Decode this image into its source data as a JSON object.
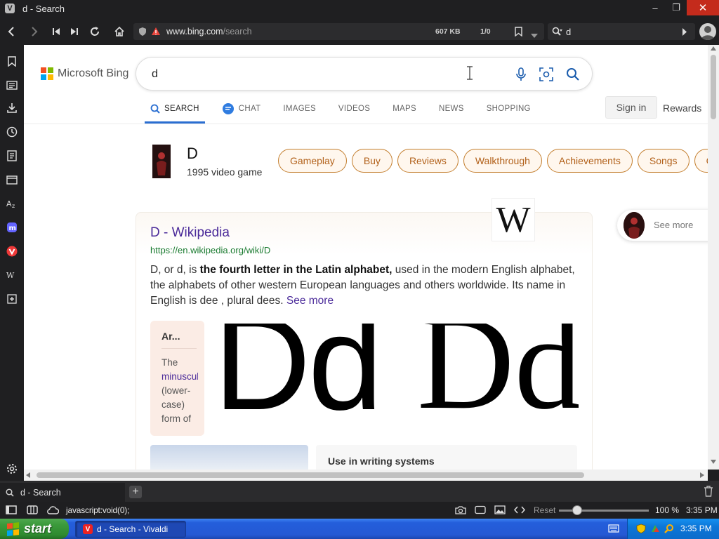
{
  "window": {
    "title": "d - Search",
    "minimize": "–",
    "maximize": "❐",
    "close": "✕"
  },
  "address_bar": {
    "url_domain": "www.bing.com",
    "url_path": "/search",
    "page_size": "607 KB",
    "tracker_count": "1/0"
  },
  "search_field": {
    "value": "d"
  },
  "bing": {
    "logo_text": "Microsoft Bing",
    "query": "d",
    "tabs": [
      "SEARCH",
      "CHAT",
      "IMAGES",
      "VIDEOS",
      "MAPS",
      "NEWS",
      "SHOPPING"
    ],
    "sign_in": "Sign in",
    "rewards": "Rewards"
  },
  "entity": {
    "name": "D",
    "description": "1995 video game",
    "chips": [
      "Gameplay",
      "Buy",
      "Reviews",
      "Walkthrough",
      "Achievements",
      "Songs",
      "C"
    ]
  },
  "result": {
    "title": "D - Wikipedia",
    "url": "https://en.wikipedia.org/wiki/D",
    "wiki_logo": "W",
    "snippet_pre": "D, or d, is ",
    "snippet_bold": "the fourth letter in the Latin alphabet,",
    "snippet_post": " used in the modern English alphabet, the alphabets of other western European languages and others worldwide. Its name in English is dee , plural dees. ",
    "see_more": "See more",
    "article_title": "Ar...",
    "article_text_1": "The",
    "article_link": "minuscule",
    "article_text_2": "(lower-",
    "article_text_3": "case)",
    "article_text_4": "form of",
    "glyph_sans": "Dd",
    "glyph_serif": "Dd",
    "writing_systems": "Use in writing systems"
  },
  "side_panel": {
    "see_more": "See more"
  },
  "tab_bar": {
    "active_tab": "d - Search",
    "new_tab": "+"
  },
  "status_bar": {
    "link": "javascript:void(0);",
    "reset": "Reset",
    "zoom_label": "100 %",
    "zoom_level": 0.2,
    "time": "3:35 PM"
  },
  "taskbar": {
    "start": "start",
    "task_item": "d - Search - Vivaldi",
    "time": "3:35 PM"
  },
  "colors": {
    "accent_blue": "#2a6ed1",
    "link_purple": "#4b2b9a",
    "url_green": "#1a7b30",
    "chip_orange": "#b2611a",
    "close_red": "#c42b1c"
  }
}
